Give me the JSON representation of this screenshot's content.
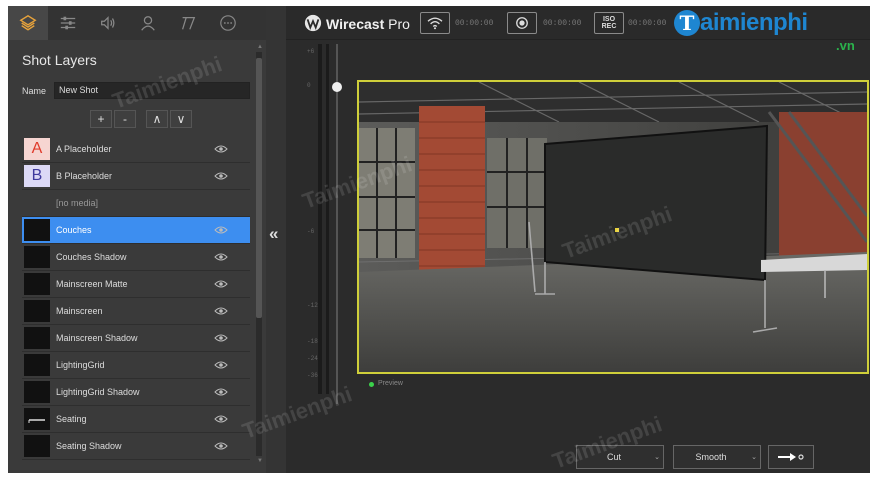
{
  "toolbar": {
    "tabs": [
      {
        "name": "layers-icon",
        "active": true
      },
      {
        "name": "sliders-icon",
        "active": false
      },
      {
        "name": "speaker-icon",
        "active": false
      },
      {
        "name": "user-icon",
        "active": false
      },
      {
        "name": "titles-icon",
        "active": false
      },
      {
        "name": "more-icon",
        "active": false
      }
    ]
  },
  "shot_panel": {
    "title": "Shot Layers",
    "name_label": "Name",
    "name_value": "New Shot",
    "add_label": "+",
    "remove_label": "-",
    "up_label": "∧",
    "down_label": "∨",
    "layers": [
      {
        "thumb": "A",
        "label": "A Placeholder",
        "kind": "a"
      },
      {
        "thumb": "B",
        "label": "B Placeholder",
        "kind": "b"
      },
      {
        "thumb": "",
        "label": "[no media]",
        "kind": "none"
      },
      {
        "thumb": "",
        "label": "Couches",
        "kind": "dark",
        "selected": true
      },
      {
        "thumb": "",
        "label": "Couches Shadow",
        "kind": "dark"
      },
      {
        "thumb": "",
        "label": "Mainscreen Matte",
        "kind": "dark"
      },
      {
        "thumb": "",
        "label": "Mainscreen",
        "kind": "dark"
      },
      {
        "thumb": "",
        "label": "Mainscreen Shadow",
        "kind": "dark"
      },
      {
        "thumb": "",
        "label": "LightingGrid",
        "kind": "dark"
      },
      {
        "thumb": "",
        "label": "LightingGrid Shadow",
        "kind": "dark"
      },
      {
        "thumb": "",
        "label": "Seating",
        "kind": "seat"
      },
      {
        "thumb": "",
        "label": "Seating Shadow",
        "kind": "dark"
      }
    ],
    "collapse_glyph": "«"
  },
  "header": {
    "brand": "Wirecast",
    "edition": "Pro",
    "stream_time": "00:00:00",
    "record_time": "00:00:00",
    "iso_time": "00:00:00",
    "iso_top": "ISO",
    "iso_bottom": "REC"
  },
  "watermark": {
    "letter": "T",
    "text": "aimienphi",
    "suffix": ".vn"
  },
  "meter": {
    "ticks": [
      "+6",
      "0",
      "-6",
      "-12",
      "-18",
      "-24",
      "-36"
    ]
  },
  "preview": {
    "label": "Preview"
  },
  "transitions": {
    "first": "Cut",
    "second": "Smooth"
  },
  "colors": {
    "accent_selected": "#3d8ef0",
    "preview_border": "#cfcf3a",
    "active_tab": "#e8a33b",
    "watermark_blue": "#1e86d1",
    "watermark_green": "#2bb24c"
  }
}
